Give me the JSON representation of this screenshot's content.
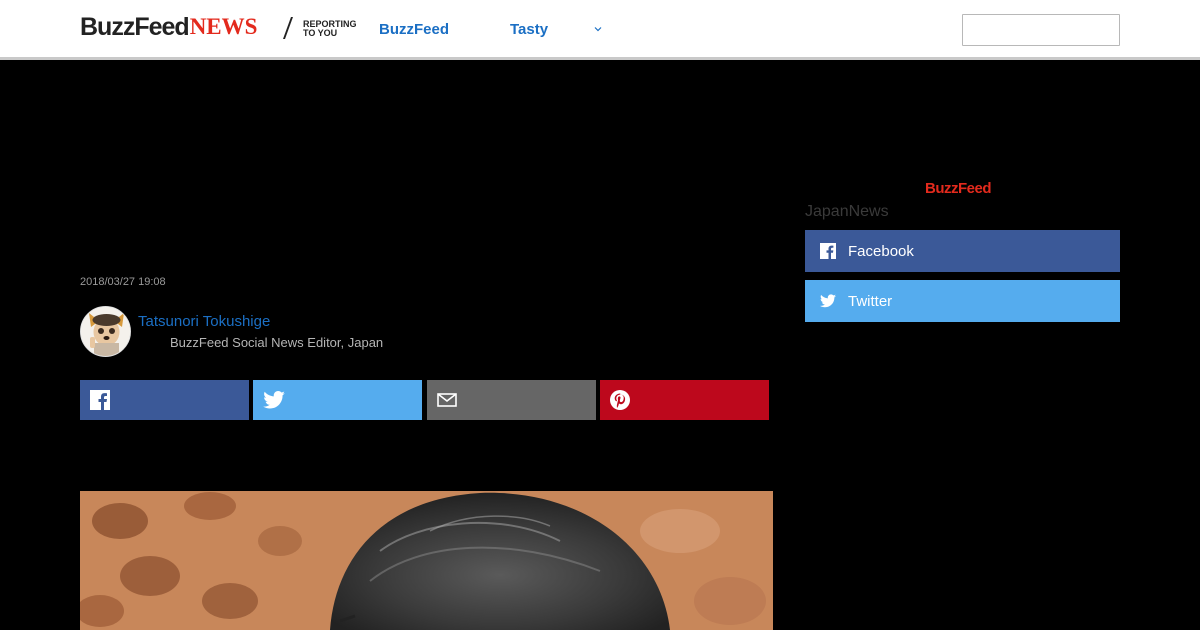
{
  "header": {
    "logo_buzzfeed": "BuzzFeed",
    "logo_news": "NEWS",
    "tagline_line1": "REPORTING",
    "tagline_line2": "TO YOU",
    "nav": {
      "buzzfeed": "BuzzFeed",
      "tasty": "Tasty"
    },
    "search_placeholder": ""
  },
  "article": {
    "timestamp": "2018/03/27 19:08",
    "author_name": "Tatsunori Tokushige",
    "author_title": "BuzzFeed Social News Editor, Japan"
  },
  "share": {
    "icons": [
      "facebook-icon",
      "twitter-icon",
      "email-icon",
      "pinterest-icon"
    ]
  },
  "sidebar": {
    "logo": "BuzzFeed",
    "handle": "JapanNews",
    "facebook_label": "Facebook",
    "twitter_label": "Twitter"
  },
  "colors": {
    "brand_red": "#e32a1d",
    "link_blue": "#1b6fc4",
    "facebook": "#3b5998",
    "twitter": "#55acee",
    "email": "#666666",
    "pinterest": "#bd081c"
  }
}
